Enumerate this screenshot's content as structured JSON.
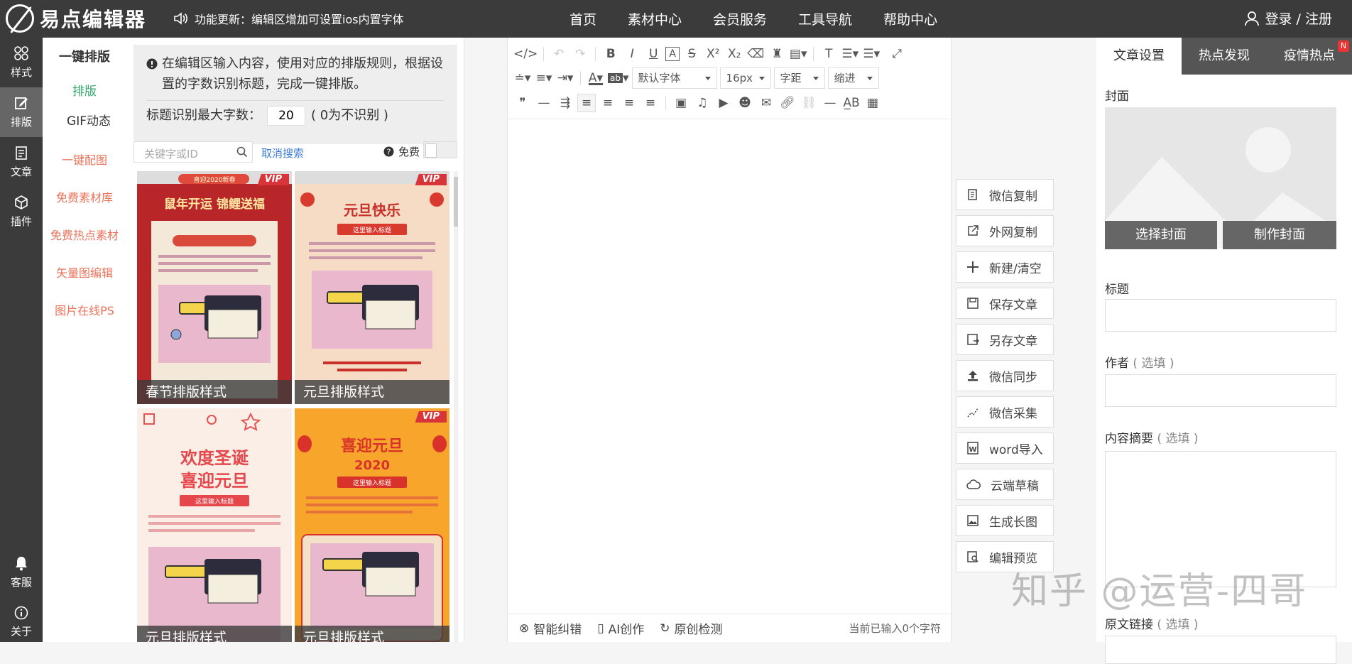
{
  "header": {
    "logo_text": "易点编辑器",
    "notice": "功能更新：编辑区增加可设置ios内置字体",
    "nav": [
      "首页",
      "素材中心",
      "会员服务",
      "工具导航",
      "帮助中心"
    ],
    "login": "登录 / 注册"
  },
  "leftbar": {
    "items": [
      {
        "label": "样式",
        "icon": "styles-icon"
      },
      {
        "label": "排版",
        "icon": "layout-icon"
      },
      {
        "label": "文章",
        "icon": "article-icon"
      },
      {
        "label": "插件",
        "icon": "plugin-icon"
      }
    ],
    "bottom": [
      {
        "label": "客服",
        "icon": "bell-icon"
      },
      {
        "label": "关于",
        "icon": "info-icon"
      }
    ]
  },
  "submenu": {
    "title": "一键排版",
    "active": "排版",
    "gif": "GIF动态",
    "links": [
      "一键配图",
      "免费素材库",
      "免费热点素材",
      "矢量图编辑",
      "图片在线PS"
    ]
  },
  "panel": {
    "tip": "在编辑区输入内容，使用对应的排版规则，根据设置的字数识别标题，完成一键排版。",
    "max_label": "标题识别最大字数：",
    "max_value": "20",
    "max_hint": "( 0为不识别 )",
    "search_placeholder": "关键字或ID",
    "cancel_search": "取消搜索",
    "free_label": "免费",
    "cards": [
      {
        "caption": "春节排版样式",
        "vip": "VIP",
        "headline": "鼠年开运 锦鲤送福",
        "badge": "喜迎2020新春"
      },
      {
        "caption": "元旦排版样式",
        "vip": "VIP",
        "headline": "元旦快乐",
        "badge": "这里输入标题"
      },
      {
        "caption": "元旦排版样式",
        "vip": "",
        "headline": "欢度圣诞 喜迎元旦",
        "badge": "这里输入标题"
      },
      {
        "caption": "元旦排版样式",
        "vip": "VIP",
        "headline": "喜迎元旦 2020",
        "badge": "这里输入标题"
      }
    ]
  },
  "editor": {
    "font_family": "默认字体",
    "font_size": "16px",
    "spacing": "字距",
    "indent": "缩进",
    "footer": {
      "check": "智能纠错",
      "ai": "AI创作",
      "original": "原创检测",
      "count": "当前已输入0个字符"
    }
  },
  "actions": [
    {
      "label": "微信复制",
      "icon": "copy-icon"
    },
    {
      "label": "外网复制",
      "icon": "share-icon"
    },
    {
      "label": "新建/清空",
      "icon": "plus-icon"
    },
    {
      "label": "保存文章",
      "icon": "save-icon"
    },
    {
      "label": "另存文章",
      "icon": "save-as-icon"
    },
    {
      "label": "微信同步",
      "icon": "upload-icon"
    },
    {
      "label": "微信采集",
      "icon": "collect-icon"
    },
    {
      "label": "word导入",
      "icon": "word-icon"
    },
    {
      "label": "云端草稿",
      "icon": "cloud-icon"
    },
    {
      "label": "生成长图",
      "icon": "image-icon"
    },
    {
      "label": "编辑预览",
      "icon": "preview-icon"
    }
  ],
  "settings": {
    "tabs": [
      "文章设置",
      "热点发现",
      "疫情热点"
    ],
    "badge": "N",
    "cover_label": "封面",
    "choose_cover": "选择封面",
    "make_cover": "制作封面",
    "title_label": "标题",
    "author_label": "作者",
    "summary_label": "内容摘要",
    "link_label": "原文链接",
    "optional": "( 选填 )"
  },
  "watermark": "知乎 @运营-四哥",
  "colors": {
    "dark_bar": "#3b3b3b",
    "accent_green": "#35a96a",
    "link_orange": "#e8735a",
    "vip_red": "#d9343a"
  }
}
